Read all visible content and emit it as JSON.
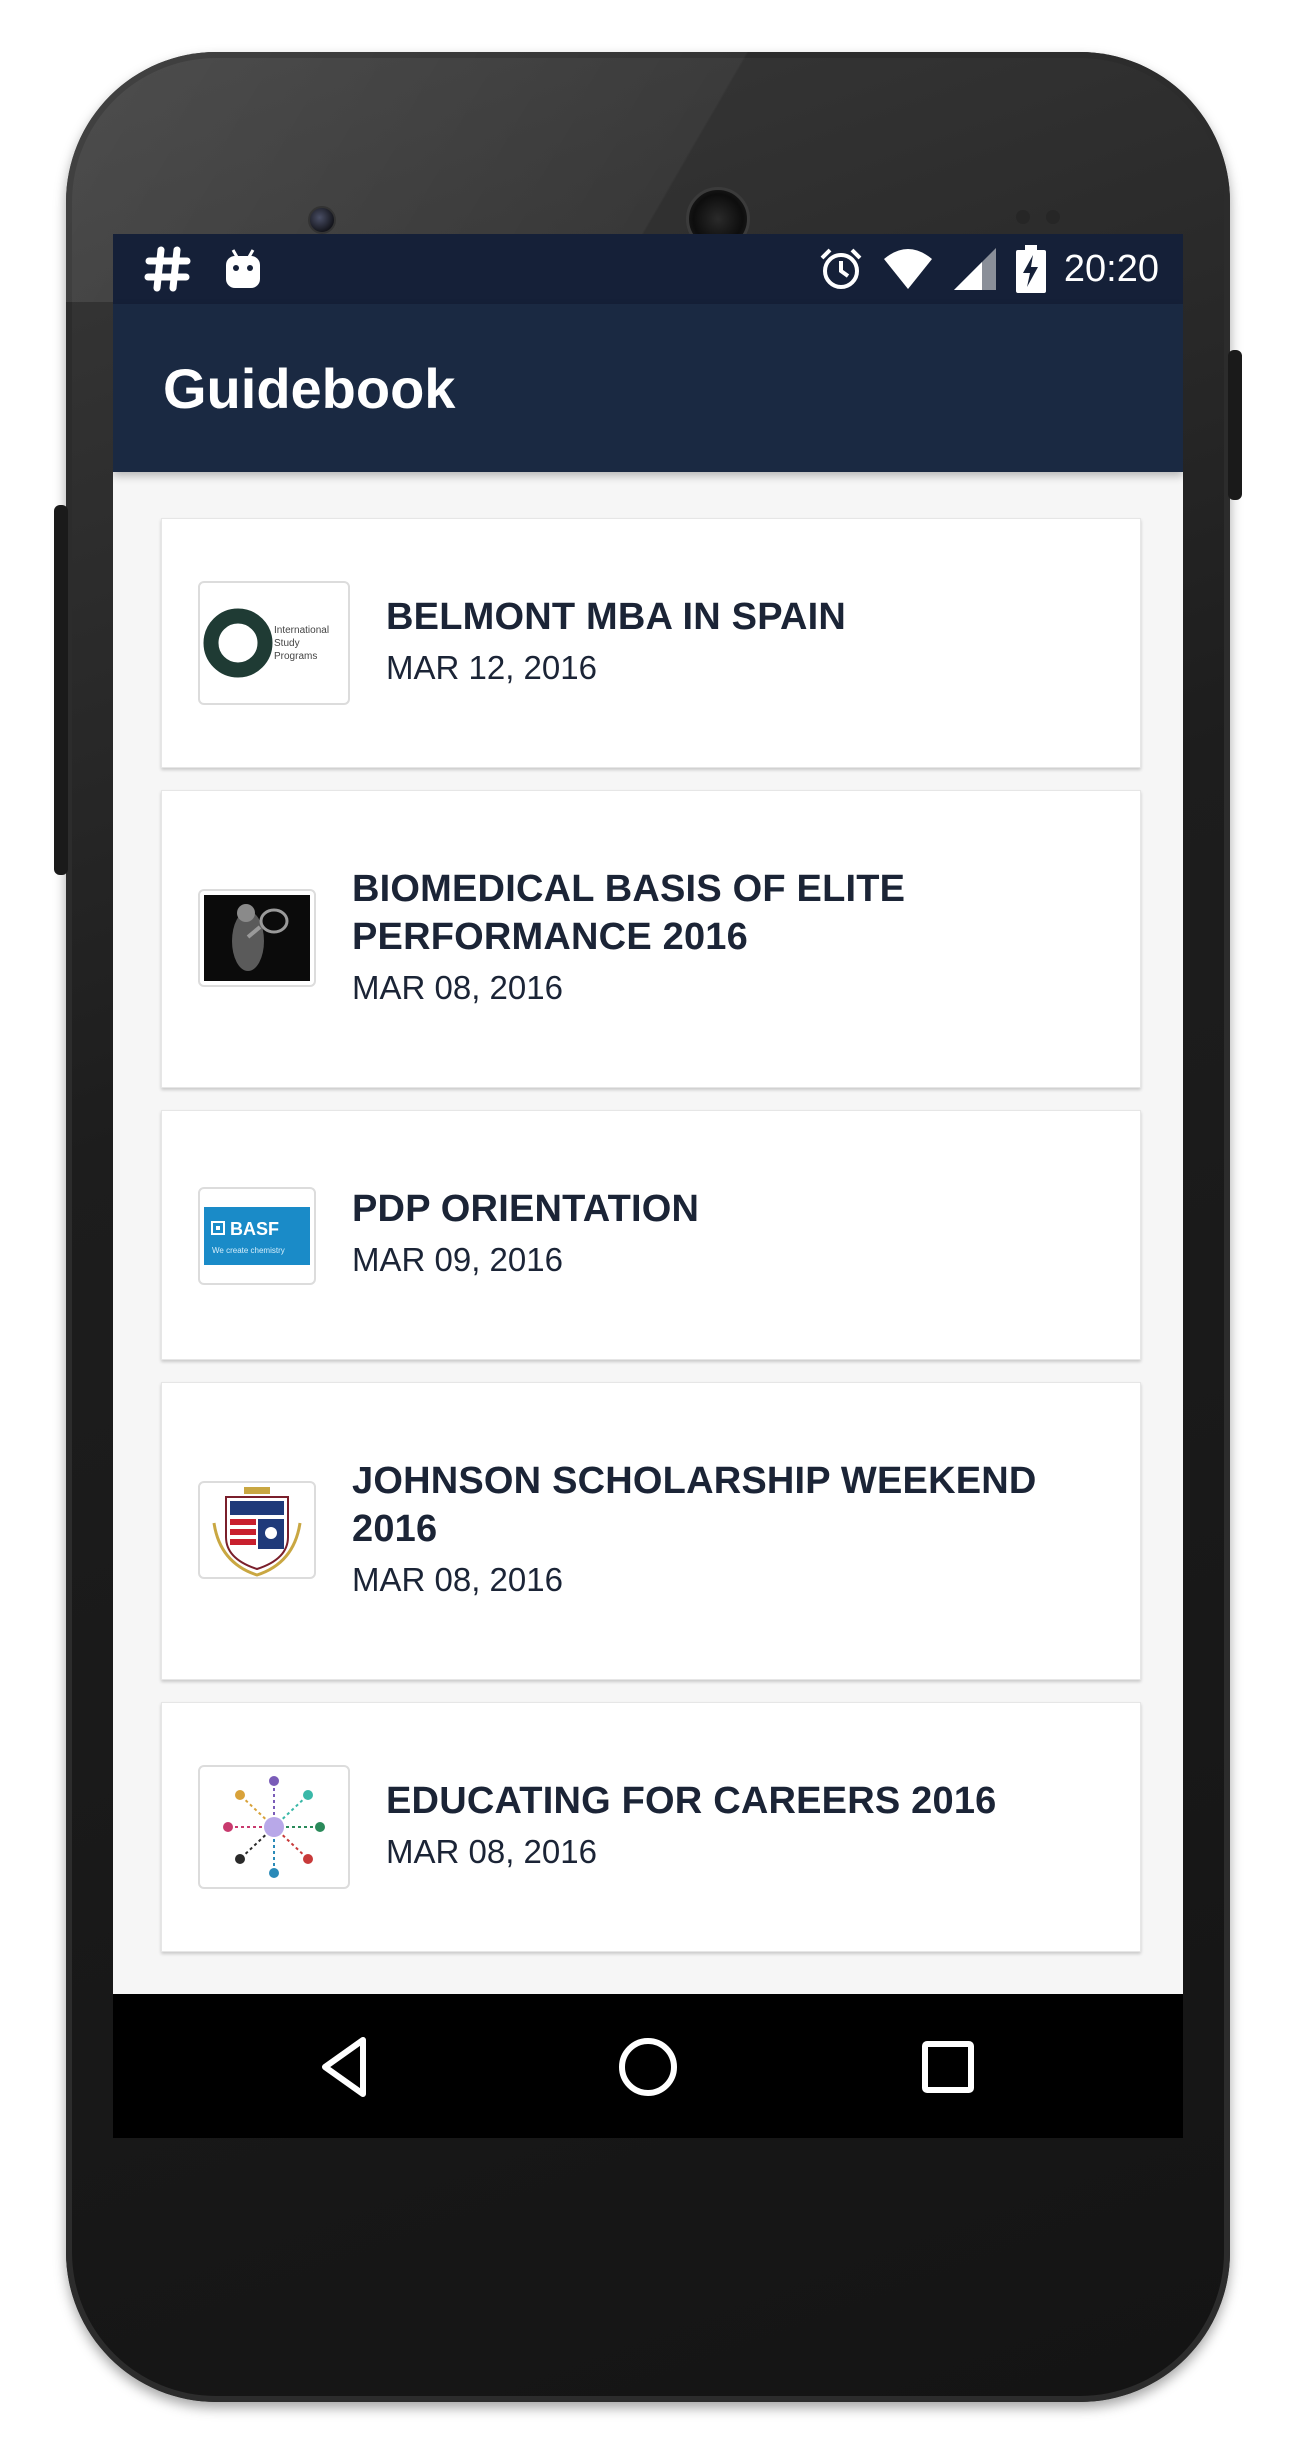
{
  "status_bar": {
    "time": "20:20",
    "left_icons": [
      "hashtag-icon",
      "android-debug-icon"
    ],
    "right_icons": [
      "alarm-icon",
      "wifi-icon",
      "cell-signal-icon",
      "battery-charging-icon"
    ]
  },
  "app_bar": {
    "title": "Guidebook"
  },
  "guides": [
    {
      "title": "BELMONT MBA IN SPAIN",
      "date": "MAR 12, 2016",
      "thumb_text": [
        "International",
        "Study",
        "Programs"
      ]
    },
    {
      "title": "BIOMEDICAL BASIS OF ELITE PERFORMANCE 2016",
      "date": "MAR 08, 2016"
    },
    {
      "title": "PDP ORIENTATION",
      "date": "MAR 09, 2016",
      "thumb_text": [
        "BASF",
        "We create chemistry"
      ]
    },
    {
      "title": "JOHNSON SCHOLARSHIP WEEKEND 2016",
      "date": "MAR 08, 2016"
    },
    {
      "title": "EDUCATING FOR CAREERS 2016",
      "date": "MAR 08, 2016"
    }
  ],
  "nav_bar": {
    "icons": [
      "back-icon",
      "home-icon",
      "recents-icon"
    ]
  },
  "colors": {
    "status_bar": "#152038",
    "app_bar": "#1a2942",
    "text_dark": "#1b2436",
    "basf_blue": "#1a8bc8"
  }
}
